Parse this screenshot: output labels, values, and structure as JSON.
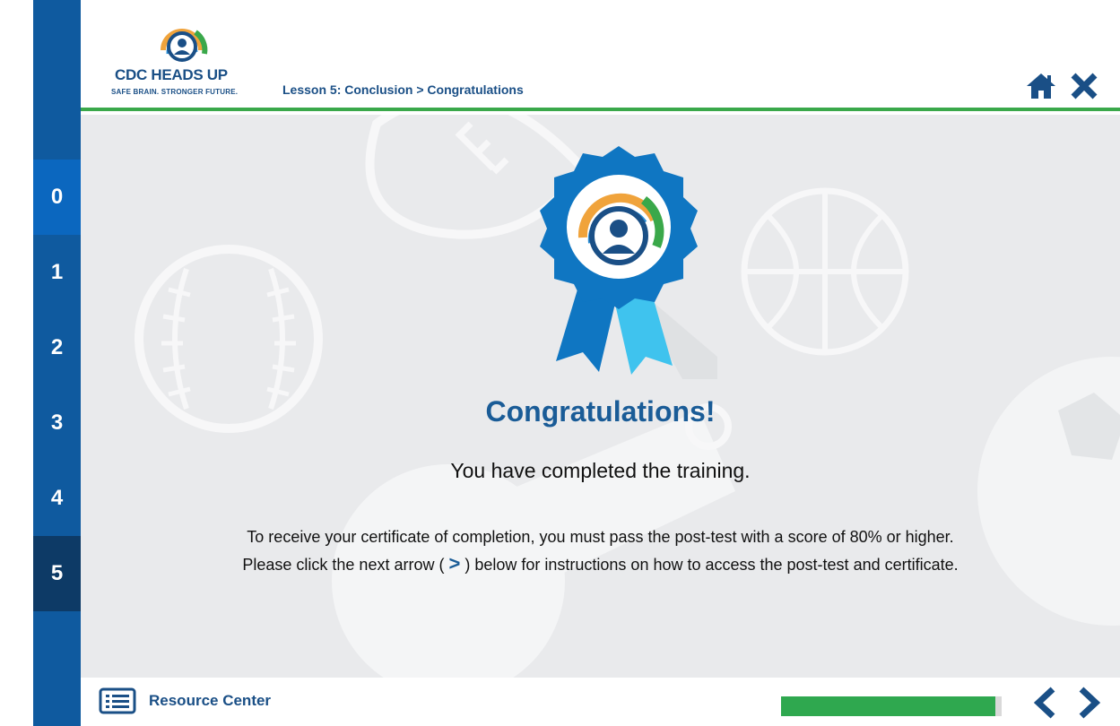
{
  "brand": {
    "title": "CDC HEADS UP",
    "tagline": "SAFE BRAIN. STRONGER FUTURE."
  },
  "header": {
    "breadcrumb": "Lesson 5: Conclusion > Congratulations",
    "home_icon": "home-icon",
    "close_icon": "close-icon"
  },
  "sidebar": {
    "items": [
      {
        "label": "0"
      },
      {
        "label": "1"
      },
      {
        "label": "2"
      },
      {
        "label": "3"
      },
      {
        "label": "4"
      },
      {
        "label": "5"
      }
    ]
  },
  "content": {
    "heading": "Congratulations!",
    "subheading": "You have completed the training.",
    "line1": "To receive your certificate of completion, you must pass the post-test with a score of 80% or higher.",
    "line2_before": "Please click the next arrow (",
    "line2_arrow": ">",
    "line2_after": ") below for instructions on how to access the post-test and certificate."
  },
  "footer": {
    "resource_center_label": "Resource Center",
    "progress_fraction": 0.97
  },
  "colors": {
    "sidebar": "#0f5a9f",
    "sidebar_active": "#0b67bf",
    "sidebar_current": "#0d3a66",
    "brand_blue": "#1a4f86",
    "accent_green": "#3aa84a",
    "progress_green": "#2fa84f",
    "stage_bg": "#e9eaec"
  }
}
